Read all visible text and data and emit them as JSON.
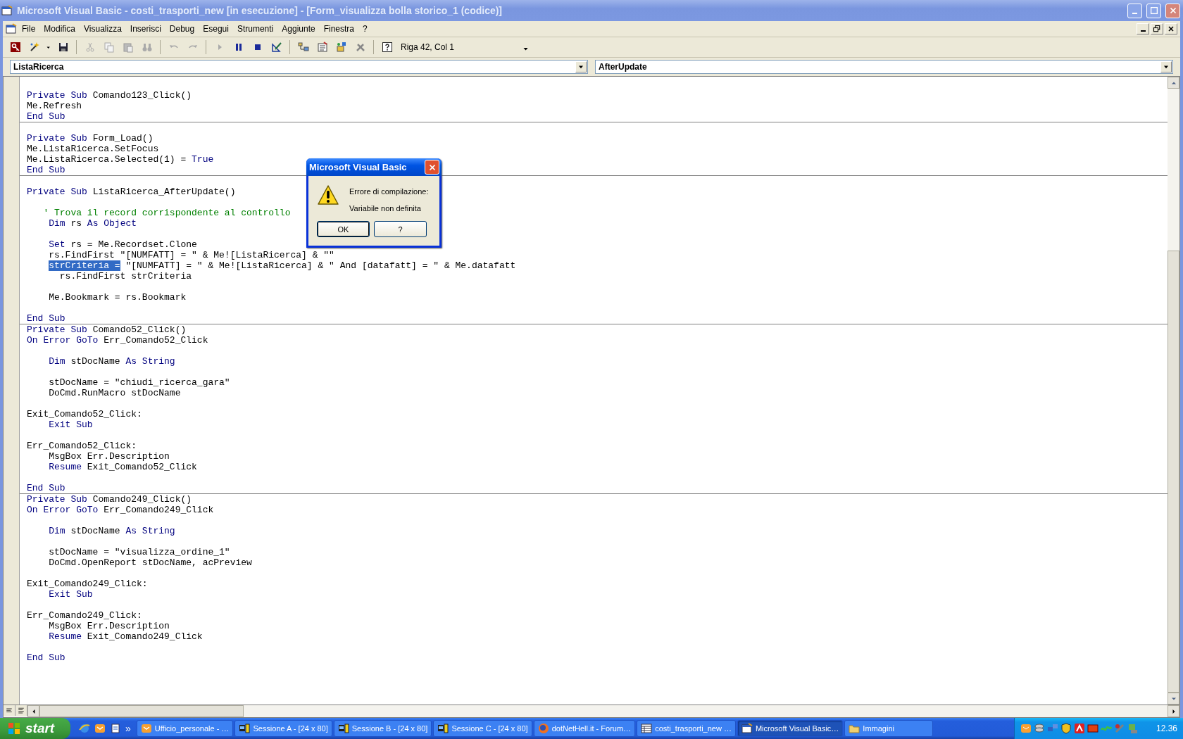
{
  "window": {
    "title": "Microsoft Visual Basic - costi_trasporti_new [in esecuzione] - [Form_visualizza bolla storico_1 (codice)]"
  },
  "menu": [
    "File",
    "Modifica",
    "Visualizza",
    "Inserisci",
    "Debug",
    "Esegui",
    "Strumenti",
    "Aggiunte",
    "Finestra",
    "?"
  ],
  "toolbar": {
    "position": "Riga 42, Col 1"
  },
  "object_combo": "ListaRicerca",
  "procedure_combo": "AfterUpdate",
  "code": {
    "procedures": [
      {
        "lines": [
          {
            "kind": "blank"
          },
          {
            "kind": "code",
            "tokens": [
              {
                "kind": "keyword",
                "text": "Private Sub"
              },
              {
                "kind": "plain",
                "text": " Comando123_Click()"
              }
            ]
          },
          {
            "kind": "code",
            "tokens": [
              {
                "kind": "plain",
                "text": "Me.Refresh"
              }
            ]
          },
          {
            "kind": "code",
            "tokens": [
              {
                "kind": "keyword",
                "text": "End Sub"
              }
            ]
          }
        ]
      },
      {
        "lines": [
          {
            "kind": "blank"
          },
          {
            "kind": "code",
            "tokens": [
              {
                "kind": "keyword",
                "text": "Private Sub"
              },
              {
                "kind": "plain",
                "text": " Form_Load()"
              }
            ]
          },
          {
            "kind": "code",
            "tokens": [
              {
                "kind": "plain",
                "text": "Me.ListaRicerca.SetFocus"
              }
            ]
          },
          {
            "kind": "code",
            "tokens": [
              {
                "kind": "plain",
                "text": "Me.ListaRicerca.Selected(1) = "
              },
              {
                "kind": "keyword",
                "text": "True"
              }
            ]
          },
          {
            "kind": "code",
            "tokens": [
              {
                "kind": "keyword",
                "text": "End Sub"
              }
            ]
          }
        ]
      },
      {
        "lines": [
          {
            "kind": "blank"
          },
          {
            "kind": "code",
            "tokens": [
              {
                "kind": "keyword",
                "text": "Private Sub"
              },
              {
                "kind": "plain",
                "text": " ListaRicerca_AfterUpdate()"
              }
            ]
          },
          {
            "kind": "blank"
          },
          {
            "kind": "code",
            "tokens": [
              {
                "kind": "comment",
                "text": "   ' Trova il record corrispondente al controllo"
              }
            ]
          },
          {
            "kind": "code",
            "tokens": [
              {
                "kind": "keyword",
                "text": "    Dim"
              },
              {
                "kind": "plain",
                "text": " rs "
              },
              {
                "kind": "keyword",
                "text": "As Object"
              }
            ]
          },
          {
            "kind": "blank"
          },
          {
            "kind": "code",
            "tokens": [
              {
                "kind": "keyword",
                "text": "    Set"
              },
              {
                "kind": "plain",
                "text": " rs = Me.Recordset.Clone"
              }
            ]
          },
          {
            "kind": "code",
            "tokens": [
              {
                "kind": "plain",
                "text": "    rs.FindFirst \"[NUMFATT] = \" & Me![ListaRicerca] & \"\""
              }
            ]
          },
          {
            "kind": "code",
            "indented": true,
            "tokens": [
              {
                "kind": "selection",
                "text": "strCriteria ="
              },
              {
                "kind": "plain",
                "text": " \"[NUMFATT] = \" & Me![ListaRicerca] & \" And [datafatt] = \" & Me.datafatt"
              }
            ]
          },
          {
            "kind": "code",
            "tokens": [
              {
                "kind": "plain",
                "text": "      rs.FindFirst strCriteria"
              }
            ]
          },
          {
            "kind": "blank"
          },
          {
            "kind": "code",
            "tokens": [
              {
                "kind": "plain",
                "text": "    Me.Bookmark = rs.Bookmark"
              }
            ]
          },
          {
            "kind": "blank"
          },
          {
            "kind": "code",
            "tokens": [
              {
                "kind": "keyword",
                "text": "End Sub"
              }
            ]
          }
        ]
      },
      {
        "lines": [
          {
            "kind": "code",
            "tokens": [
              {
                "kind": "keyword",
                "text": "Private Sub"
              },
              {
                "kind": "plain",
                "text": " Comando52_Click()"
              }
            ]
          },
          {
            "kind": "code",
            "tokens": [
              {
                "kind": "keyword",
                "text": "On Error GoTo"
              },
              {
                "kind": "plain",
                "text": " Err_Comando52_Click"
              }
            ]
          },
          {
            "kind": "blank"
          },
          {
            "kind": "code",
            "tokens": [
              {
                "kind": "keyword",
                "text": "    Dim"
              },
              {
                "kind": "plain",
                "text": " stDocName "
              },
              {
                "kind": "keyword",
                "text": "As String"
              }
            ]
          },
          {
            "kind": "blank"
          },
          {
            "kind": "code",
            "tokens": [
              {
                "kind": "plain",
                "text": "    stDocName = \"chiudi_ricerca_gara\""
              }
            ]
          },
          {
            "kind": "code",
            "tokens": [
              {
                "kind": "plain",
                "text": "    DoCmd.RunMacro stDocName"
              }
            ]
          },
          {
            "kind": "blank"
          },
          {
            "kind": "code",
            "tokens": [
              {
                "kind": "plain",
                "text": "Exit_Comando52_Click:"
              }
            ]
          },
          {
            "kind": "code",
            "tokens": [
              {
                "kind": "keyword",
                "text": "    Exit Sub"
              }
            ]
          },
          {
            "kind": "blank"
          },
          {
            "kind": "code",
            "tokens": [
              {
                "kind": "plain",
                "text": "Err_Comando52_Click:"
              }
            ]
          },
          {
            "kind": "code",
            "tokens": [
              {
                "kind": "plain",
                "text": "    MsgBox Err.Description"
              }
            ]
          },
          {
            "kind": "code",
            "tokens": [
              {
                "kind": "keyword",
                "text": "    Resume"
              },
              {
                "kind": "plain",
                "text": " Exit_Comando52_Click"
              }
            ]
          },
          {
            "kind": "blank"
          },
          {
            "kind": "code",
            "tokens": [
              {
                "kind": "keyword",
                "text": "End Sub"
              }
            ]
          }
        ]
      },
      {
        "lines": [
          {
            "kind": "code",
            "tokens": [
              {
                "kind": "keyword",
                "text": "Private Sub"
              },
              {
                "kind": "plain",
                "text": " Comando249_Click()"
              }
            ]
          },
          {
            "kind": "code",
            "tokens": [
              {
                "kind": "keyword",
                "text": "On Error GoTo"
              },
              {
                "kind": "plain",
                "text": " Err_Comando249_Click"
              }
            ]
          },
          {
            "kind": "blank"
          },
          {
            "kind": "code",
            "tokens": [
              {
                "kind": "keyword",
                "text": "    Dim"
              },
              {
                "kind": "plain",
                "text": " stDocName "
              },
              {
                "kind": "keyword",
                "text": "As String"
              }
            ]
          },
          {
            "kind": "blank"
          },
          {
            "kind": "code",
            "tokens": [
              {
                "kind": "plain",
                "text": "    stDocName = \"visualizza_ordine_1\""
              }
            ]
          },
          {
            "kind": "code",
            "tokens": [
              {
                "kind": "plain",
                "text": "    DoCmd.OpenReport stDocName, acPreview"
              }
            ]
          },
          {
            "kind": "blank"
          },
          {
            "kind": "code",
            "tokens": [
              {
                "kind": "plain",
                "text": "Exit_Comando249_Click:"
              }
            ]
          },
          {
            "kind": "code",
            "tokens": [
              {
                "kind": "keyword",
                "text": "    Exit Sub"
              }
            ]
          },
          {
            "kind": "blank"
          },
          {
            "kind": "code",
            "tokens": [
              {
                "kind": "plain",
                "text": "Err_Comando249_Click:"
              }
            ]
          },
          {
            "kind": "code",
            "tokens": [
              {
                "kind": "plain",
                "text": "    MsgBox Err.Description"
              }
            ]
          },
          {
            "kind": "code",
            "tokens": [
              {
                "kind": "keyword",
                "text": "    Resume"
              },
              {
                "kind": "plain",
                "text": " Exit_Comando249_Click"
              }
            ]
          },
          {
            "kind": "blank"
          },
          {
            "kind": "code",
            "tokens": [
              {
                "kind": "keyword",
                "text": "End Sub"
              }
            ]
          }
        ]
      }
    ]
  },
  "dialog": {
    "title": "Microsoft Visual Basic",
    "heading": "Errore di compilazione:",
    "message": "Variabile non definita",
    "buttons": [
      "OK",
      "?"
    ]
  },
  "taskbar": {
    "start": "start",
    "tasks": [
      {
        "kind": "envelope",
        "label": "Ufficio_personale - …",
        "selected": false
      },
      {
        "kind": "terminal",
        "label": "Sessione A - [24 x 80]",
        "selected": false
      },
      {
        "kind": "terminal",
        "label": "Sessione B - [24 x 80]",
        "selected": false
      },
      {
        "kind": "terminal",
        "label": "Sessione C - [24 x 80]",
        "selected": false
      },
      {
        "kind": "globe",
        "label": "dotNetHell.it - Forum…",
        "selected": false
      },
      {
        "kind": "table",
        "label": "costi_trasporti_new …",
        "selected": false
      },
      {
        "kind": "window",
        "label": "Microsoft Visual Basic…",
        "selected": true
      },
      {
        "kind": "folder",
        "label": "Immagini",
        "selected": false
      }
    ],
    "more": "»",
    "clock": "12.36"
  }
}
